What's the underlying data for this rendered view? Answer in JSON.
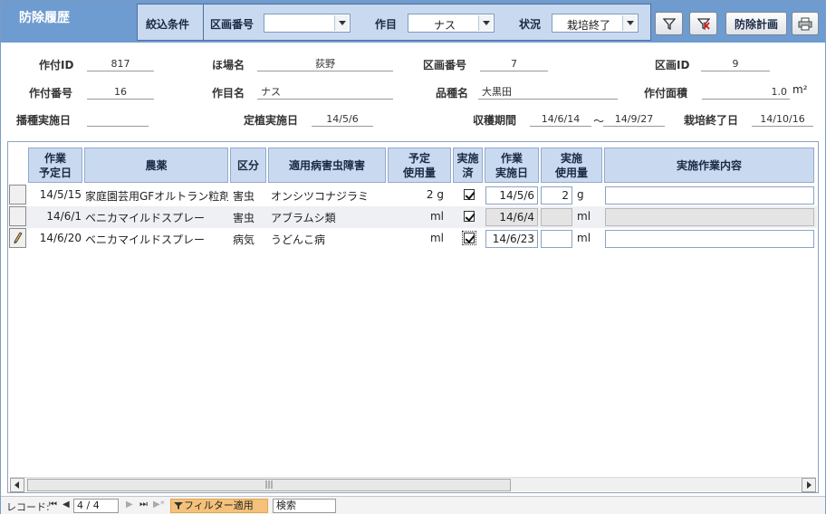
{
  "header": {
    "title": "防除履歴",
    "filter_label": "絞込条件",
    "block_label": "区画番号",
    "block_value": "",
    "crop_label": "作目",
    "crop_value": "ナス",
    "status_label": "状況",
    "status_value": "栽培終了",
    "plan_button": "防除計画"
  },
  "info": {
    "crop_id_label": "作付ID",
    "crop_id": "817",
    "field_label": "ほ場名",
    "field": "荻野",
    "block_label": "区画番号",
    "block": "7",
    "block_id_label": "区画ID",
    "block_id": "9",
    "crop_no_label": "作付番号",
    "crop_no": "16",
    "crop_name_label": "作目名",
    "crop_name": "ナス",
    "variety_label": "品種名",
    "variety": "大黒田",
    "area_label": "作付面積",
    "area": "1.0",
    "area_unit": "m²",
    "sowing_label": "播種実施日",
    "sowing": "",
    "planting_label": "定植実施日",
    "planting": "14/5/6",
    "harvest_label": "収穫期間",
    "harvest_start": "14/6/14",
    "harvest_sep": "～",
    "harvest_end": "14/9/27",
    "end_label": "栽培終了日",
    "end": "14/10/16"
  },
  "grid": {
    "headers": [
      "作業\n予定日",
      "農薬",
      "区分",
      "適用病害虫障害",
      "予定\n使用量",
      "実施\n済",
      "作業\n実施日",
      "実施\n使用量",
      "実施作業内容"
    ],
    "rows": [
      {
        "planned": "14/5/15",
        "pesticide": "家庭園芸用GFオルトラン粒剤",
        "kind": "害虫",
        "target": "オンシツコナジラミ",
        "plan_amt": "2 g",
        "done": true,
        "date": "14/5/6",
        "amt": "2",
        "unit": "g",
        "content": "",
        "disabled": false
      },
      {
        "planned": "14/6/1",
        "pesticide": "ベニカマイルドスプレー",
        "kind": "害虫",
        "target": "アブラムシ類",
        "plan_amt": "ml",
        "done": true,
        "date": "14/6/4",
        "amt": "",
        "unit": "ml",
        "content": "",
        "disabled": true
      },
      {
        "planned": "14/6/20",
        "pesticide": "ベニカマイルドスプレー",
        "kind": "病気",
        "target": "うどんこ病",
        "plan_amt": "ml",
        "done": true,
        "date": "14/6/23",
        "amt": "",
        "unit": "ml",
        "content": "",
        "disabled": false
      }
    ]
  },
  "navbar": {
    "record_label": "レコード:",
    "record_value": "4 / 4",
    "filter_applied": "フィルター適用",
    "search_placeholder": "検索"
  }
}
